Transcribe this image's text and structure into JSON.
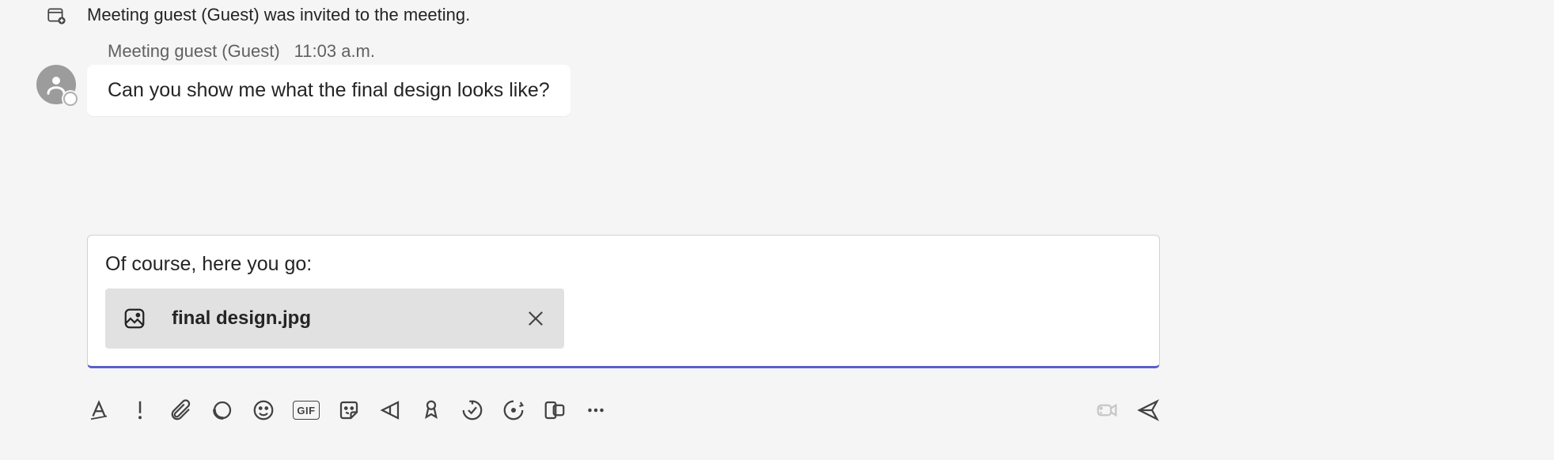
{
  "system_event": {
    "text": "Meeting guest (Guest) was invited to the meeting."
  },
  "message": {
    "sender": "Meeting guest (Guest)",
    "timestamp": "11:03 a.m.",
    "text": "Can you show me what the final design looks like?"
  },
  "composer": {
    "text": "Of course, here you go:",
    "attachment": {
      "filename": "final design.jpg"
    }
  },
  "toolbar": {
    "gif_label": "GIF"
  }
}
